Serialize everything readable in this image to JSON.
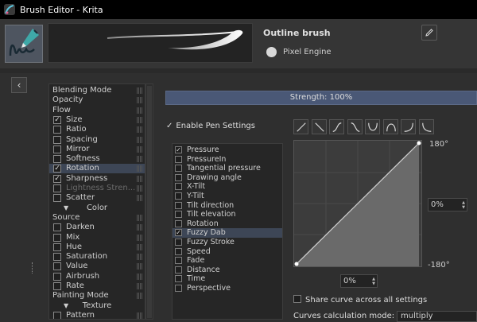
{
  "window": {
    "title": "Brush Editor - Krita"
  },
  "preset": {
    "name": "Outline brush",
    "engine": "Pixel Engine"
  },
  "strength": {
    "label": "Strength: 100%",
    "value": 1.0
  },
  "options": [
    {
      "label": "Blending Mode",
      "kind": "plain",
      "checked": false
    },
    {
      "label": "Opacity",
      "kind": "plain",
      "checked": false
    },
    {
      "label": "Flow",
      "kind": "plain",
      "checked": false
    },
    {
      "label": "Size",
      "kind": "check",
      "checked": true
    },
    {
      "label": "Ratio",
      "kind": "check",
      "checked": false
    },
    {
      "label": "Spacing",
      "kind": "check",
      "checked": false
    },
    {
      "label": "Mirror",
      "kind": "check",
      "checked": false
    },
    {
      "label": "Softness",
      "kind": "check",
      "checked": false
    },
    {
      "label": "Rotation",
      "kind": "check",
      "checked": true,
      "selected": true
    },
    {
      "label": "Sharpness",
      "kind": "check",
      "checked": true
    },
    {
      "label": "Lightness Stren...",
      "kind": "check",
      "checked": false,
      "disabled": true
    },
    {
      "label": "Scatter",
      "kind": "check",
      "checked": false
    },
    {
      "label": "Color",
      "kind": "category",
      "checked": false
    },
    {
      "label": "Source",
      "kind": "plain",
      "checked": false
    },
    {
      "label": "Darken",
      "kind": "check",
      "checked": false
    },
    {
      "label": "Mix",
      "kind": "check",
      "checked": false
    },
    {
      "label": "Hue",
      "kind": "check",
      "checked": false
    },
    {
      "label": "Saturation",
      "kind": "check",
      "checked": false
    },
    {
      "label": "Value",
      "kind": "check",
      "checked": false
    },
    {
      "label": "Airbrush",
      "kind": "check",
      "checked": false
    },
    {
      "label": "Rate",
      "kind": "check",
      "checked": false
    },
    {
      "label": "Painting Mode",
      "kind": "plain",
      "checked": false
    },
    {
      "label": "Texture",
      "kind": "category",
      "checked": false
    },
    {
      "label": "Pattern",
      "kind": "check",
      "checked": false
    }
  ],
  "enable_pen_settings": {
    "label": "Enable Pen Settings",
    "checked": true
  },
  "sensors": [
    {
      "label": "Pressure",
      "checked": true
    },
    {
      "label": "PressureIn",
      "checked": false
    },
    {
      "label": "Tangential pressure",
      "checked": false
    },
    {
      "label": "Drawing angle",
      "checked": false
    },
    {
      "label": "X-Tilt",
      "checked": false
    },
    {
      "label": "Y-Tilt",
      "checked": false
    },
    {
      "label": "Tilt direction",
      "checked": false
    },
    {
      "label": "Tilt elevation",
      "checked": false
    },
    {
      "label": "Rotation",
      "checked": false
    },
    {
      "label": "Fuzzy Dab",
      "checked": true,
      "selected": true
    },
    {
      "label": "Fuzzy Stroke",
      "checked": false
    },
    {
      "label": "Speed",
      "checked": false
    },
    {
      "label": "Fade",
      "checked": false
    },
    {
      "label": "Distance",
      "checked": false
    },
    {
      "label": "Time",
      "checked": false
    },
    {
      "label": "Perspective",
      "checked": false
    }
  ],
  "curve": {
    "max_label": "180°",
    "min_label": "-180°",
    "y_value": "0%",
    "x_value": "0%",
    "points": [
      [
        0,
        0
      ],
      [
        1,
        1
      ]
    ]
  },
  "share_curve": {
    "label": "Share curve across all settings",
    "checked": false
  },
  "calc_mode": {
    "label": "Curves calculation mode:",
    "value": "multiply"
  },
  "colors": {
    "accent": "#4a5876",
    "selection": "#3d4656",
    "background": "#2f2f2f"
  }
}
